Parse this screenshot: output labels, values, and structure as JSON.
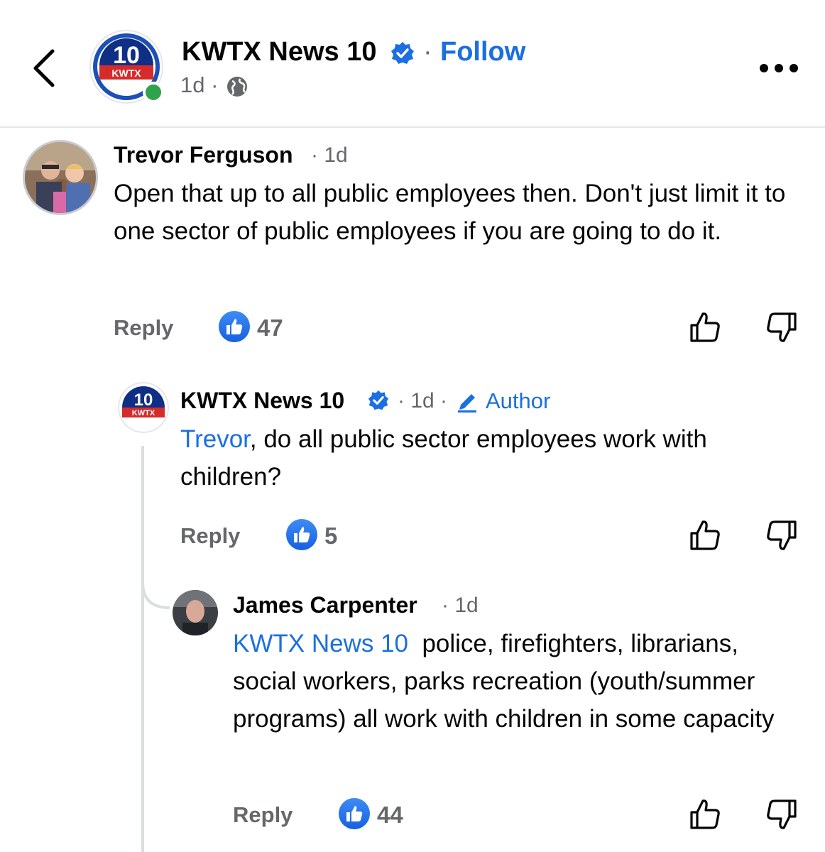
{
  "header": {
    "page_name": "KWTX News 10",
    "separator": "·",
    "follow_label": "Follow",
    "age": "1d ·",
    "logo_text_top": "10",
    "logo_text_bottom": "KWTX"
  },
  "comments": [
    {
      "author": "Trevor Ferguson",
      "time": "· 1d",
      "text": "Open that up to all public employees then. Don't just limit it to one sector of public employees if you are going to do it.",
      "reply_label": "Reply",
      "likes": "47"
    },
    {
      "author": "KWTX News 10",
      "time": "· 1d ·",
      "author_tag": "Author",
      "mention": "Trevor",
      "text": ", do all public sector employees work with children?",
      "reply_label": "Reply",
      "likes": "5"
    },
    {
      "author": "James Carpenter",
      "time": "· 1d",
      "mention": "KWTX News 10",
      "text": "  police, firefighters, librarians, social workers, parks recreation (youth/summer programs) all work with children in some capacity",
      "reply_label": "Reply",
      "likes": "44"
    }
  ],
  "colors": {
    "link_blue": "#1b6fe0",
    "muted_gray": "#65676b",
    "online_green": "#31a24c"
  },
  "icons": [
    "back-chevron-icon",
    "verified-badge-icon",
    "globe-icon",
    "more-options-icon",
    "like-badge-icon",
    "thumbs-up-icon",
    "thumbs-down-icon",
    "pencil-icon"
  ]
}
